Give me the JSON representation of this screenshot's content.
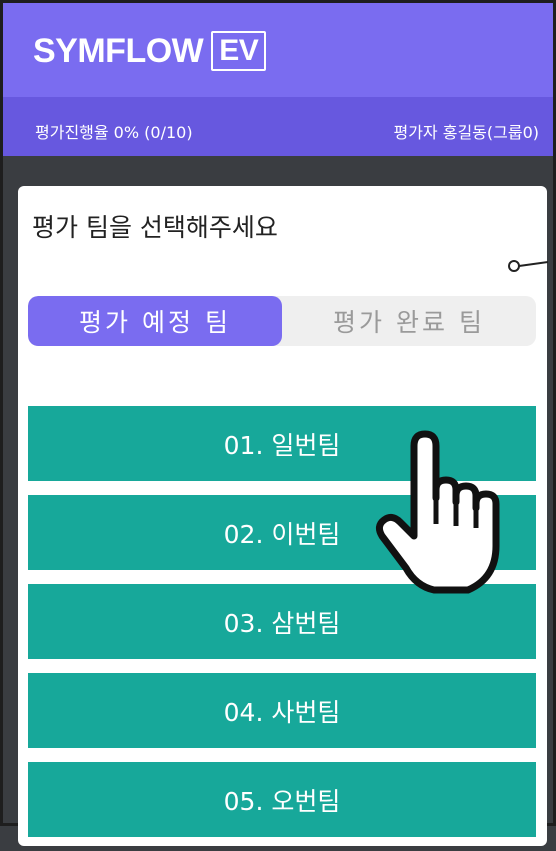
{
  "header": {
    "logo_main": "SYMFLOW",
    "logo_badge": "EV",
    "color": "#7a6cf0"
  },
  "status": {
    "progress": "평가진행율 0% (0/10)",
    "evaluator": "평가자 홍길동(그룹0)"
  },
  "main": {
    "prompt": "평가 팀을 선택해주세요",
    "tabs": [
      {
        "label": "평가 예정 팀",
        "active": true
      },
      {
        "label": "평가 완료 팀",
        "active": false
      }
    ],
    "teams": [
      {
        "label": "01. 일번팀"
      },
      {
        "label": "02. 이번팀"
      },
      {
        "label": "03. 삼번팀"
      },
      {
        "label": "04. 사번팀"
      },
      {
        "label": "05. 오번팀"
      }
    ],
    "team_color": "#17a89a"
  },
  "cursor_icon": "hand-pointer-icon"
}
